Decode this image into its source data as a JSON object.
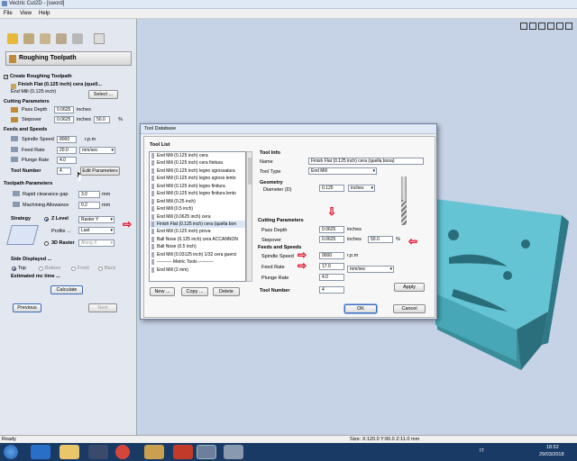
{
  "window": {
    "title": "Vectric Cut2D - [sword]"
  },
  "menu": [
    "File",
    "View",
    "Help"
  ],
  "panel": {
    "heading": "Roughing Toolpath",
    "create_label": "Create Roughing Toolpath",
    "tool_name": "Finish Flat (0.125 inch) cera (quell...",
    "tool_sub": "End Mill (0.125 inch)",
    "select_btn": "Select ...",
    "cutting_params": "Cutting Parameters",
    "pass_depth_label": "Pass Depth",
    "pass_depth_value": "0.0625",
    "pass_depth_unit": "inches",
    "stepover_label": "Stepover",
    "stepover_value": "0.0625",
    "stepover_unit": "inches",
    "stepover_pct": "50.0",
    "pct": "%",
    "feeds_speeds": "Feeds and Speeds",
    "spindle_label": "Spindle Speed",
    "spindle_value": "8000",
    "spindle_unit": "r.p.m",
    "feed_label": "Feed Rate",
    "feed_value": "20.0",
    "feed_unit": "mm/sec",
    "plunge_label": "Plunge Rate",
    "plunge_value": "4.0",
    "tool_number_label": "Tool Number",
    "tool_number_value": "4",
    "edit_params_btn": "Edit Parameters",
    "toolpath_params": "Toolpath Parameters",
    "rapid_label": "Rapid clearance gap",
    "rapid_value": "3.0",
    "rapid_unit": "mm",
    "allowance_label": "Machining Allowance",
    "allowance_value": "0.2",
    "allowance_unit": "mm",
    "strategy_label": "Strategy",
    "zlevel_label": "Z Level",
    "raster_value": "Raster Y",
    "profile_label": "Profile ...",
    "profile_value": "Last",
    "raster3d_label": "3D Raster",
    "along_value": "Along X",
    "side_label": "Side Displayed ...",
    "top_label": "Top",
    "bottom_label": "Bottom",
    "front_label": "Front",
    "back_label": "Back",
    "estimated_label": "Estimated mc time ...",
    "calculate_btn": "Calculate",
    "previous_btn": "Previous",
    "next_btn": "Next"
  },
  "dialog": {
    "title": "Tool Database",
    "tool_list_label": "Tool List",
    "tools": [
      "End Mill (0.125 inch) cera",
      "End Mill (0.125 inch) cera finitura",
      "End Mill (0.125 inch) legno sgrossatura",
      "End Mill (0.125 inch) legno sgross lento",
      "End Mill (0.125 inch) legno finitura",
      "End Mill (0.125 inch) legno finitura lento",
      "End Mill (0.25 inch)",
      "End Mill (0.5 inch)",
      "End Mill (0.0625 inch) cera",
      "Finish Flat (0.125 inch) cera (quella bon",
      "End Mill (0.125 inch) prova",
      "Ball Nose (0.125 inch) cera ACCANNON",
      "Ball Nose (0.5 inch)",
      "End Mill (0.03125 inch) 1/32 cera guerci",
      "---------- Metric Tools ----------",
      "End Mill (2 mm)"
    ],
    "selected_index": 9,
    "new_btn": "New ...",
    "copy_btn": "Copy ...",
    "delete_btn": "Delete",
    "tool_info": "Tool Info",
    "name_label": "Name",
    "name_value": "Finish Flat (0.125 inch) cera (quella bona)",
    "tool_type_label": "Tool Type",
    "tool_type_value": "End Mill",
    "geometry": "Geometry",
    "diameter_label": "Diameter (D)",
    "diameter_value": "0.125",
    "diameter_unit": "inches",
    "cutting_params": "Cutting Parameters",
    "pass_depth_label": "Pass Depth",
    "pass_depth_value": "0.0625",
    "pass_depth_unit": "inches",
    "stepover_label": "Stepover",
    "stepover_value": "0.0625",
    "stepover_unit": "inches",
    "stepover_pct": "50.0",
    "pct": "%",
    "feeds_speeds": "Feeds and Speeds",
    "spindle_label": "Spindle Speed",
    "spindle_value": "9000",
    "spindle_unit": "r.p.m",
    "feed_label": "Feed Rate",
    "feed_value": "17.0",
    "feed_unit": "mm/sec",
    "plunge_label": "Plunge Rate",
    "plunge_value": "4.0",
    "tool_number_label": "Tool Number",
    "tool_number_value": "4",
    "apply_btn": "Apply",
    "ok_btn": "OK",
    "cancel_btn": "Cancel"
  },
  "status": {
    "left": "Ready",
    "coords": "Size: X:120.0 Y:90.0 Z:11.0 mm"
  },
  "taskbar": {
    "lang": "IT",
    "time": "18:52",
    "date": "29/03/2018"
  },
  "colors": {
    "accent": "#e2001a",
    "model": "#64c4d4"
  }
}
